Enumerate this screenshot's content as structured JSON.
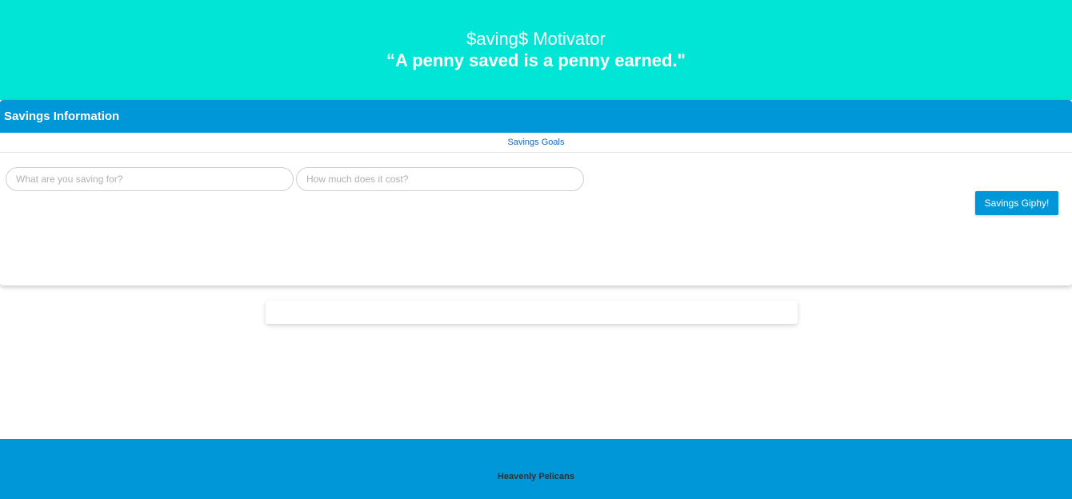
{
  "hero": {
    "title": "$aving$ Motivator",
    "quote": "“A penny saved is a penny earned.\""
  },
  "savings_card": {
    "header": "Savings Information",
    "tabs": [
      {
        "label": "Savings Goals"
      }
    ],
    "inputs": {
      "item": {
        "placeholder": "What are you saving for?",
        "value": ""
      },
      "cost": {
        "placeholder": "How much does it cost?",
        "value": ""
      }
    },
    "button_label": "Savings Giphy!"
  },
  "footer": {
    "text": "Heavenly Pelicans"
  },
  "colors": {
    "hero_background": "#00e5d6",
    "primary": "#0097d9",
    "tab_text": "#1565c0",
    "footer_text": "#263238"
  }
}
